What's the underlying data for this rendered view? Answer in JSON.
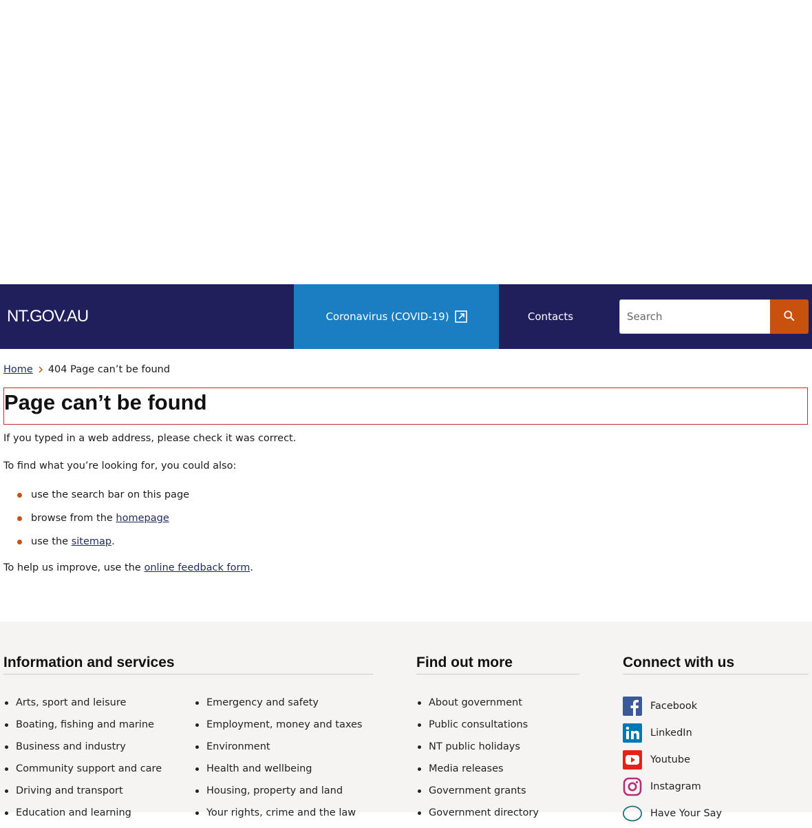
{
  "header": {
    "logo": "NT.GOV.AU",
    "covid_link": "Coronavirus (COVID-19)",
    "contacts": "Contacts",
    "search_placeholder": "Search"
  },
  "breadcrumb": {
    "home": "Home",
    "current": "404 Page can’t be found"
  },
  "main": {
    "title": "Page can’t be found",
    "para1": "If you typed in a web address, please check it was correct.",
    "para2": "To find what you’re looking for, you could also:",
    "bullets": {
      "b1": "use the search bar on this page",
      "b2_prefix": "browse from the ",
      "b2_link": "homepage",
      "b3_prefix": "use the ",
      "b3_link": "sitemap",
      "b3_suffix": "."
    },
    "feedback_prefix": "To help us improve, use the ",
    "feedback_link": "online feedback form",
    "feedback_suffix": "."
  },
  "footer": {
    "info_heading": "Information and services",
    "info_col1": [
      "Arts, sport and leisure",
      "Boating, fishing and marine",
      "Business and industry",
      "Community support and care",
      "Driving and transport",
      "Education and learning"
    ],
    "info_col2": [
      "Emergency and safety",
      "Employment, money and taxes",
      "Environment",
      "Health and wellbeing",
      "Housing, property and land",
      "Your rights, crime and the law"
    ],
    "more_heading": "Find out more",
    "more_items": [
      "About government",
      "Public consultations",
      "NT public holidays",
      "Media releases",
      "Government grants",
      "Government directory"
    ],
    "connect_heading": "Connect with us",
    "social": [
      {
        "label": "Facebook",
        "icon": "facebook-icon",
        "color": "#3b5998"
      },
      {
        "label": "LinkedIn",
        "icon": "linkedin-icon",
        "color": "#0077b5"
      },
      {
        "label": "Youtube",
        "icon": "youtube-icon",
        "color": "#e62117"
      },
      {
        "label": "Instagram",
        "icon": "instagram-icon",
        "color": "#b2307a"
      },
      {
        "label": "Have Your Say",
        "icon": "have-your-say-icon",
        "color": "#1b6e7a"
      }
    ]
  },
  "colors": {
    "header_bg": "#201f5c",
    "covid_bg": "#1b7dc2",
    "search_button": "#c8510e",
    "bullet_accent": "#c8510e",
    "footer_bg": "#f5f4f2",
    "title_border": "#c52a2a"
  }
}
